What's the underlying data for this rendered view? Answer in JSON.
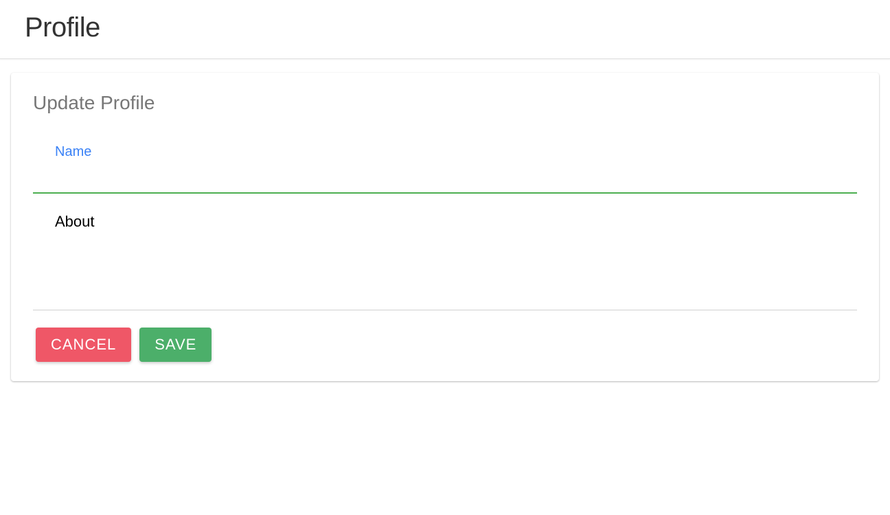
{
  "header": {
    "title": "Profile"
  },
  "card": {
    "title": "Update Profile"
  },
  "form": {
    "name": {
      "label": "Name",
      "value": ""
    },
    "about": {
      "placeholder": "About",
      "value": ""
    }
  },
  "buttons": {
    "cancel": "Cancel",
    "save": "Save"
  }
}
